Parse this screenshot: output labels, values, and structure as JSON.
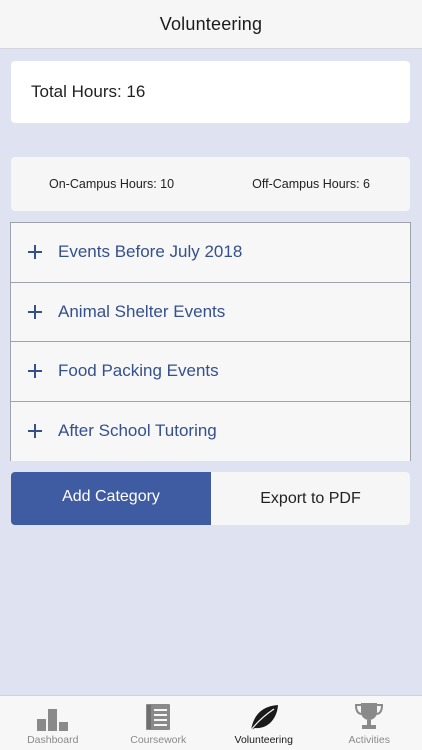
{
  "header": {
    "title": "Volunteering"
  },
  "summary": {
    "total_label": "Total Hours: 16",
    "on_campus_label": "On-Campus Hours: 10",
    "off_campus_label": "Off-Campus Hours: 6"
  },
  "categories": [
    {
      "label": "Events Before July 2018"
    },
    {
      "label": "Animal Shelter Events"
    },
    {
      "label": "Food Packing Events"
    },
    {
      "label": "After School Tutoring"
    }
  ],
  "actions": {
    "add_category": "Add Category",
    "export_pdf": "Export to PDF"
  },
  "tabbar": {
    "items": [
      {
        "label": "Dashboard",
        "icon": "bar-chart-icon"
      },
      {
        "label": "Coursework",
        "icon": "notebook-icon"
      },
      {
        "label": "Volunteering",
        "icon": "leaf-icon",
        "active": true
      },
      {
        "label": "Activities",
        "icon": "trophy-icon"
      }
    ]
  },
  "colors": {
    "accent": "#3f5ba1",
    "category_text": "#34508d",
    "background": "#dfe3f1"
  }
}
